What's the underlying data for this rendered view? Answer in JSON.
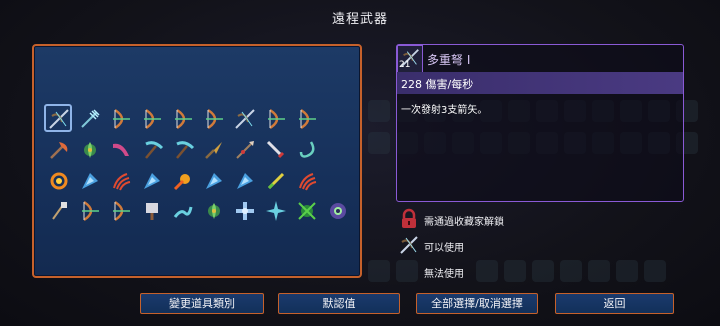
{
  "title": "遠程武器",
  "grid": {
    "selected_index": 0,
    "rows": [
      [
        "crossbow-icon",
        "trident-icon",
        "bow-icon",
        "bow-icon",
        "bow-icon",
        "bow-icon",
        "crossbow-icon",
        "bow-icon",
        "bow-icon"
      ],
      [
        "axe-icon",
        "plant-icon",
        "boomerang-icon",
        "pickaxe-icon",
        "pickaxe-icon",
        "trowel-icon",
        "spear-icon",
        "dagger-icon",
        "hook-icon"
      ],
      [
        "flame-ring-icon",
        "shard-icon",
        "claw-icon",
        "shard-icon",
        "fireball-icon",
        "shard-icon",
        "shard-icon",
        "stick-icon",
        "claw-icon"
      ],
      [
        "staff-icon",
        "bow-icon",
        "bow-icon",
        "cleaver-icon",
        "tentacle-icon",
        "plant-icon",
        "cross-icon",
        "shuriken-icon",
        "vine-icon",
        "gear-icon"
      ]
    ]
  },
  "detail": {
    "icon": "crossbow-icon",
    "count": "21",
    "name": "多重弩 I",
    "dps": "228 傷害/每秒",
    "description": "一次發射3支箭矢。"
  },
  "legend": [
    {
      "icon": "lock-icon",
      "label": "需通過收藏家解鎖"
    },
    {
      "icon": "crossbow-icon",
      "label": "可以使用"
    },
    {
      "icon": "none",
      "label": "無法使用"
    }
  ],
  "buttons": {
    "change_category": "變更道具類別",
    "default": "默認值",
    "select_all": "全部選擇/取消選擇",
    "back": "返回"
  },
  "colors": {
    "panel_border": "#c6612b",
    "detail_border": "#8a5ad6",
    "panel_bg": "#1d3a66"
  }
}
